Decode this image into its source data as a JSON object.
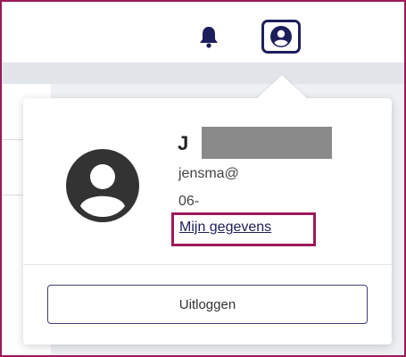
{
  "header": {
    "notifications_icon": "bell-icon",
    "profile_icon": "user-circle-icon"
  },
  "profile_menu": {
    "name_visible": "J",
    "email": "jensma@",
    "phone": "06-",
    "my_details_link": "Mijn gegevens",
    "logout_button": "Uitloggen"
  },
  "colors": {
    "accent_highlight": "#9b1a5a",
    "navy": "#1d1f5c"
  }
}
